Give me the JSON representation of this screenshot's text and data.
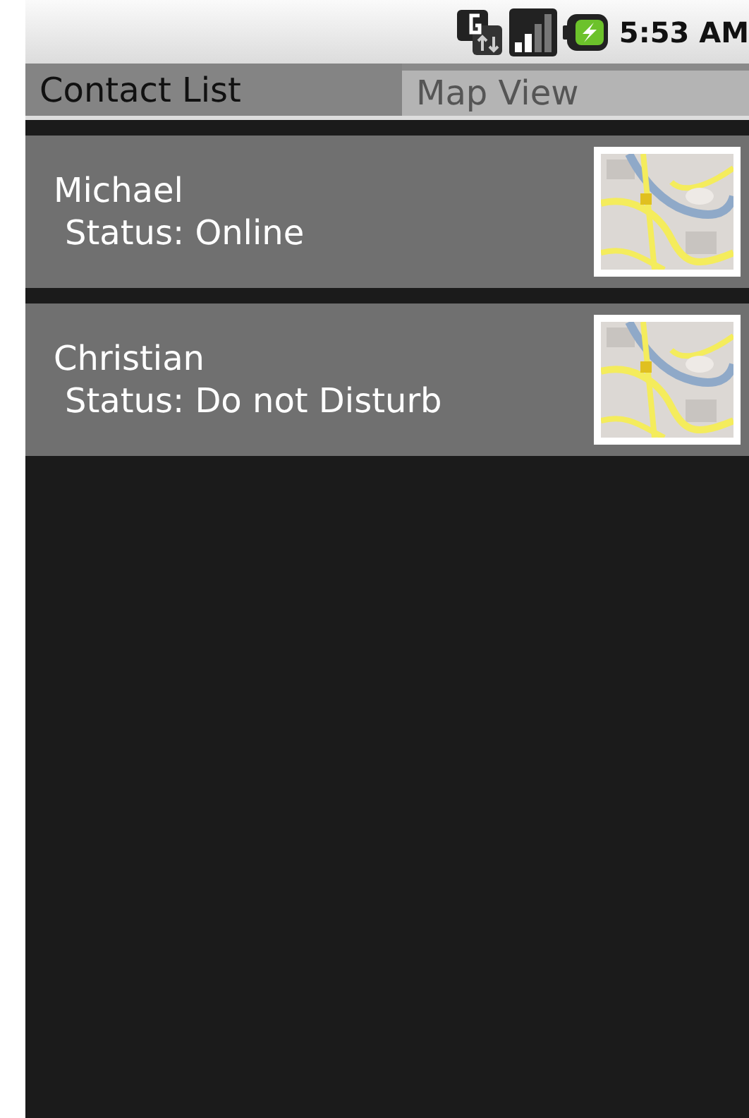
{
  "status_bar": {
    "time": "5:53 AM"
  },
  "tabs": [
    {
      "label": "Contact List",
      "selected": true
    },
    {
      "label": "Map View",
      "selected": false
    }
  ],
  "contacts": [
    {
      "name": "Michael",
      "status": "Status: Online"
    },
    {
      "name": "Christian",
      "status": "Status: Do not Disturb"
    }
  ]
}
